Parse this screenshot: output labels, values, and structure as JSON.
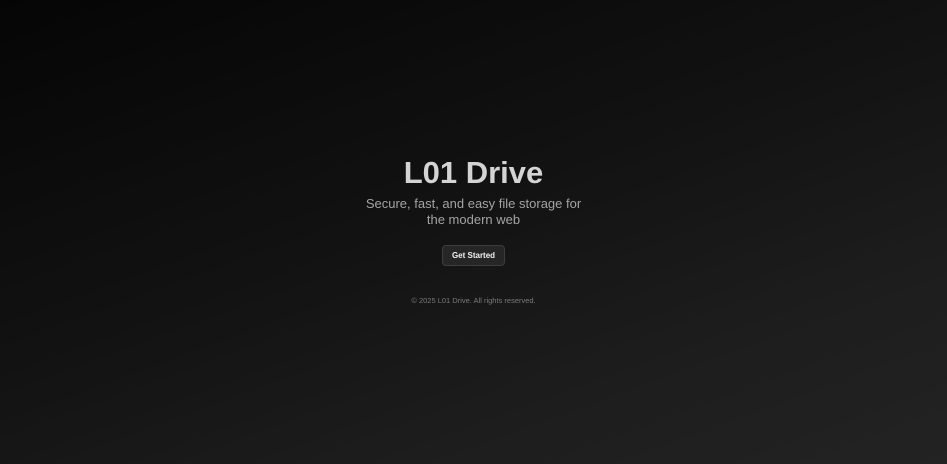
{
  "hero": {
    "title": "L01 Drive",
    "tagline": "Secure, fast, and easy file storage for the modern web",
    "cta_label": "Get Started"
  },
  "footer": {
    "copyright": "© 2025 L01 Drive. All rights reserved."
  }
}
